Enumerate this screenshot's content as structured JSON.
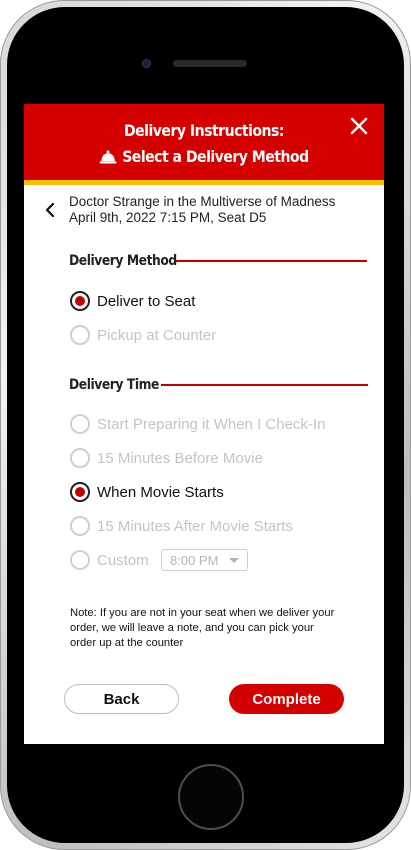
{
  "header": {
    "title": "Delivery Instructions:",
    "subtitle": "Select a Delivery Method",
    "bell_icon": "service-bell-icon",
    "close_icon": "close-icon",
    "color": "#d40000",
    "accent_color": "#f6c100"
  },
  "movie": {
    "title": "Doctor Strange in the Multiverse of Madness",
    "info": "April 9th, 2022 7:15 PM, Seat D5"
  },
  "delivery_method": {
    "heading": "Delivery Method",
    "options": [
      {
        "label": "Deliver to Seat",
        "selected": true
      },
      {
        "label": "Pickup at Counter",
        "selected": false
      }
    ]
  },
  "delivery_time": {
    "heading": "Delivery Time",
    "options": [
      {
        "label": "Start Preparing it When I Check-In",
        "selected": false
      },
      {
        "label": "15 Minutes Before Movie",
        "selected": false
      },
      {
        "label": "When Movie Starts",
        "selected": true
      },
      {
        "label": "15 Minutes After Movie Starts",
        "selected": false
      },
      {
        "label": "Custom",
        "selected": false
      }
    ],
    "custom_time_value": "8:00 PM"
  },
  "note": "Note: If you are not in your seat when we deliver your order, we will leave a note, and you can pick your order up at the counter",
  "buttons": {
    "back": "Back",
    "complete": "Complete"
  }
}
